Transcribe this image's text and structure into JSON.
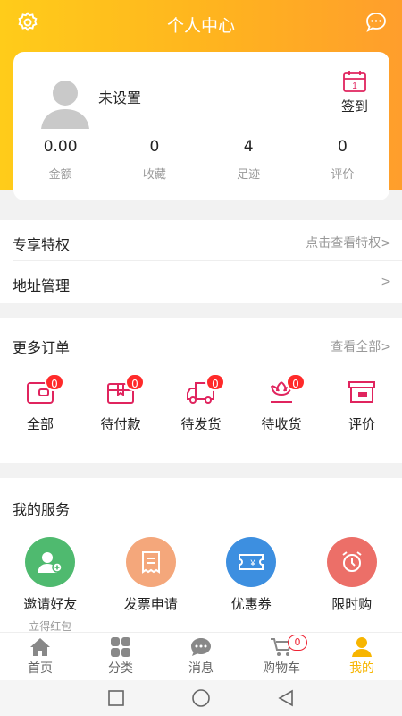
{
  "header": {
    "title": "个人中心",
    "settings_icon": "gear-icon",
    "message_icon": "chat-bubble-icon"
  },
  "profile": {
    "nickname": "未设置",
    "signin_label": "签到",
    "calendar_day": "1",
    "stats": [
      {
        "value": "0.00",
        "label": "金额"
      },
      {
        "value": "0",
        "label": "收藏"
      },
      {
        "value": "4",
        "label": "足迹"
      },
      {
        "value": "0",
        "label": "评价"
      }
    ]
  },
  "privilege": {
    "title": "专享特权",
    "link": "点击查看特权>"
  },
  "address": {
    "title": "地址管理",
    "link": ">"
  },
  "orders": {
    "title": "更多订单",
    "link": "查看全部>",
    "items": [
      {
        "label": "全部",
        "badge": "0",
        "icon": "wallet-icon"
      },
      {
        "label": "待付款",
        "badge": "0",
        "icon": "gift-box-icon"
      },
      {
        "label": "待发货",
        "badge": "0",
        "icon": "truck-icon"
      },
      {
        "label": "待收货",
        "badge": "0",
        "icon": "flower-icon"
      },
      {
        "label": "评价",
        "icon": "review-box-icon"
      }
    ]
  },
  "services": {
    "title": "我的服务",
    "items": [
      {
        "label": "邀请好友",
        "sub": "立得红包",
        "icon": "invite-user-icon",
        "color": "#4fba6f"
      },
      {
        "label": "发票申请",
        "icon": "invoice-icon",
        "color": "#f4a77b"
      },
      {
        "label": "优惠券",
        "icon": "coupon-icon",
        "color": "#3d8fe0"
      },
      {
        "label": "限时购",
        "icon": "alarm-clock-icon",
        "color": "#ec6f68"
      }
    ]
  },
  "tabbar": {
    "items": [
      {
        "label": "首页",
        "icon": "home-icon"
      },
      {
        "label": "分类",
        "icon": "grid-icon"
      },
      {
        "label": "消息",
        "icon": "message-icon"
      },
      {
        "label": "购物车",
        "icon": "cart-icon",
        "badge": "0"
      },
      {
        "label": "我的",
        "icon": "user-icon",
        "active": true
      }
    ],
    "active_color": "#f7b500"
  },
  "colors": {
    "accent": "#ffb31f",
    "badge": "#ff2a2a",
    "order_icon": "#e0245e"
  }
}
